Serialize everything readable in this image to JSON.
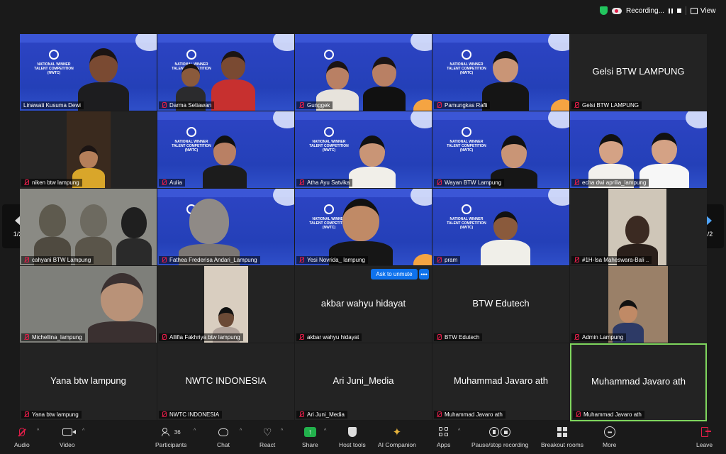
{
  "topbar": {
    "recording_label": "Recording...",
    "view_label": "View"
  },
  "gallery": {
    "tiles": [
      {
        "name": "Linawati Kusuma Dewi",
        "muted": false,
        "video": true
      },
      {
        "name": "Darma Setiawan",
        "muted": true,
        "video": true
      },
      {
        "name": "Gunggek",
        "muted": true,
        "video": true
      },
      {
        "name": "Pamungkas Rafli",
        "muted": true,
        "video": true
      },
      {
        "name": "Gelsi BTW LAMPUNG",
        "muted": true,
        "video": false
      },
      {
        "name": "niken btw lampung",
        "muted": true,
        "video": true
      },
      {
        "name": "Aulia",
        "muted": true,
        "video": true
      },
      {
        "name": "Atha Ayu Satvika",
        "muted": true,
        "video": true
      },
      {
        "name": "Wayan BTW Lampung",
        "muted": true,
        "video": true
      },
      {
        "name": "echa dwi aprilia_lampung",
        "muted": true,
        "video": true
      },
      {
        "name": "cahyani BTW Lampung",
        "muted": true,
        "video": true
      },
      {
        "name": "Fathea Frederisa Andari_Lampung",
        "muted": true,
        "video": true
      },
      {
        "name": "Yesi Novrida_ lampung",
        "muted": true,
        "video": true
      },
      {
        "name": "pram",
        "muted": true,
        "video": true
      },
      {
        "name": "#1H-Isa Maheswara-Bali ..",
        "muted": true,
        "video": true
      },
      {
        "name": "Michellina_lampung",
        "muted": true,
        "video": true
      },
      {
        "name": "Allifia Fakhriya btw lampung",
        "muted": true,
        "video": true
      },
      {
        "name": "akbar wahyu hidayat",
        "muted": true,
        "video": false
      },
      {
        "name": "BTW Edutech",
        "muted": true,
        "video": false
      },
      {
        "name": "Admin Lampung",
        "muted": true,
        "video": true
      },
      {
        "name": "Yana btw lampung",
        "muted": true,
        "video": false
      },
      {
        "name": "NWTC INDONESIA",
        "muted": true,
        "video": false
      },
      {
        "name": "Ari Juni_Media",
        "muted": true,
        "video": false
      },
      {
        "name": "Muhammad Javaro ath",
        "muted": true,
        "video": false
      },
      {
        "name": "Muhammad Javaro ath",
        "muted": true,
        "video": false,
        "active_speaker": true
      }
    ],
    "ask_to_unmute": "Ask to unmute",
    "more_dots": "•••",
    "page_indicator_left": "1/2",
    "page_indicator_right": "1/2",
    "brand_text": "NATIONAL WINNER TALENT COMPETITION (NWTC)"
  },
  "toolbar": {
    "audio": "Audio",
    "video": "Video",
    "participants": "Participants",
    "participants_count": "36",
    "chat": "Chat",
    "react": "React",
    "share": "Share",
    "host_tools": "Host tools",
    "ai_companion": "AI Companion",
    "apps": "Apps",
    "pause_stop_recording": "Pause/stop recording",
    "breakout_rooms": "Breakout rooms",
    "more": "More",
    "leave": "Leave"
  },
  "colors": {
    "background": "#1a1a1a",
    "tile_blue": "#2440b8",
    "active_border": "#7fd65e",
    "mute_red": "#e11d48",
    "unmute_blue": "#0e72ed",
    "share_green": "#22b14c"
  }
}
